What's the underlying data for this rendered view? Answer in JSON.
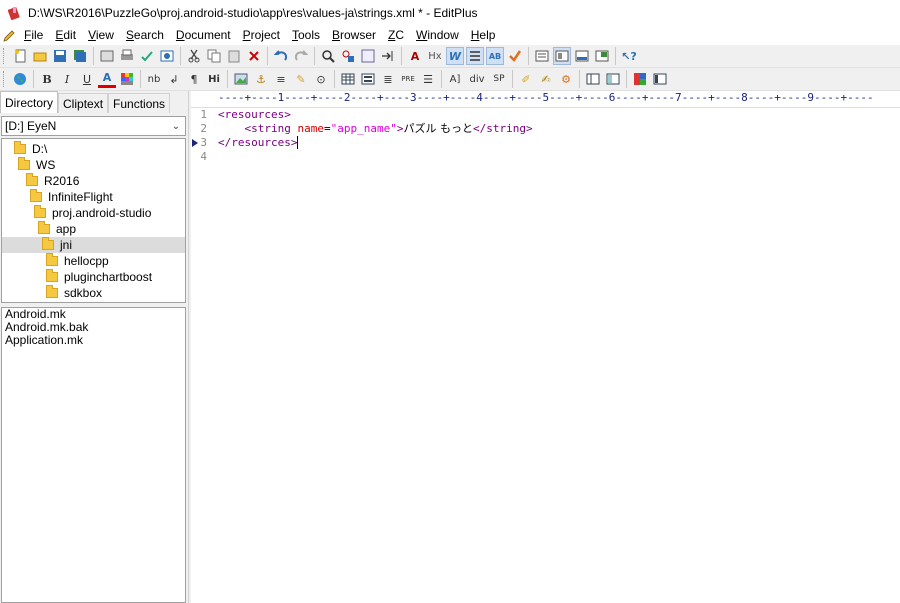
{
  "title": "D:\\WS\\R2016\\PuzzleGo\\proj.android-studio\\app\\res\\values-ja\\strings.xml * - EditPlus",
  "menu": [
    "File",
    "Edit",
    "View",
    "Search",
    "Document",
    "Project",
    "Tools",
    "Browser",
    "ZC",
    "Window",
    "Help"
  ],
  "toolbar1": [
    "new-file-icon",
    "open-file-icon",
    "save-icon",
    "save-all-icon",
    "print-preview-icon",
    "print-icon",
    "spell-check-icon",
    "browser-preview-icon",
    "cut-icon",
    "copy-icon",
    "paste-icon",
    "delete-icon",
    "undo-icon",
    "redo-icon",
    "find-icon",
    "replace-icon",
    "find-in-files-icon",
    "goto-line-icon",
    "font-size-icon",
    "hex-view-icon",
    "word-wrap-icon",
    "line-numbers-icon",
    "ruler-icon",
    "checkmark-icon",
    "directory-window-icon",
    "cliptext-window-icon",
    "output-window-icon",
    "fullscreen-icon",
    "context-help-icon"
  ],
  "toolbar2": {
    "items": [
      {
        "name": "globe-icon",
        "label": "🌐"
      },
      {
        "name": "bold-icon",
        "label": "B"
      },
      {
        "name": "italic-icon",
        "label": "I"
      },
      {
        "name": "underline-icon",
        "label": "U"
      },
      {
        "name": "font-color-icon",
        "label": "A"
      },
      {
        "name": "color-palette-icon",
        "label": "▦"
      },
      {
        "name": "nbsp-icon",
        "label": "nb"
      },
      {
        "name": "line-break-icon",
        "label": "↲"
      },
      {
        "name": "paragraph-icon",
        "label": "¶"
      },
      {
        "name": "heading-icon",
        "label": "Hi"
      },
      {
        "name": "image-icon",
        "label": "▣"
      },
      {
        "name": "anchor-icon",
        "label": "⚓"
      },
      {
        "name": "horizontal-rule-icon",
        "label": "≡"
      },
      {
        "name": "highlight-icon",
        "label": "✎"
      },
      {
        "name": "comment-icon",
        "label": "⊙"
      },
      {
        "name": "table-icon",
        "label": "▤"
      },
      {
        "name": "form-icon",
        "label": "▥"
      },
      {
        "name": "center-icon",
        "label": "≣"
      },
      {
        "name": "pre-icon",
        "label": "PRE"
      },
      {
        "name": "list-icon",
        "label": "☰"
      },
      {
        "name": "form-input-icon",
        "label": "A]"
      },
      {
        "name": "div-icon",
        "label": "div"
      },
      {
        "name": "span-icon",
        "label": "SP"
      },
      {
        "name": "edit-tag-icon",
        "label": "✐"
      },
      {
        "name": "brush-icon",
        "label": "✍"
      },
      {
        "name": "tools-icon",
        "label": "⚙"
      },
      {
        "name": "frame-icon",
        "label": "▦"
      },
      {
        "name": "layout-icon",
        "label": "▧"
      },
      {
        "name": "color-chart-icon",
        "label": "▩"
      },
      {
        "name": "window-icon",
        "label": "▢"
      }
    ]
  },
  "sidebar": {
    "tabs": [
      "Directory",
      "Cliptext",
      "Functions"
    ],
    "drive": "[D:] EyeN",
    "tree": [
      {
        "label": "D:\\",
        "depth": 0
      },
      {
        "label": "WS",
        "depth": 1
      },
      {
        "label": "R2016",
        "depth": 2
      },
      {
        "label": "InfiniteFlight",
        "depth": 3
      },
      {
        "label": "proj.android-studio",
        "depth": 4
      },
      {
        "label": "app",
        "depth": 5
      },
      {
        "label": "jni",
        "depth": 6,
        "selected": true
      },
      {
        "label": "hellocpp",
        "depth": 7
      },
      {
        "label": "pluginchartboost",
        "depth": 7
      },
      {
        "label": "sdkbox",
        "depth": 7
      }
    ],
    "files": [
      "Android.mk",
      "Android.mk.bak",
      "Application.mk"
    ]
  },
  "editor": {
    "ruler": "----+----1----+----2----+----3----+----4----+----5----+----6----+----7----+----8----+----9----+----",
    "line_numbers": [
      "1",
      "2",
      "3",
      "4"
    ],
    "lines": {
      "l1_open": "<resources>",
      "l2_indent": "    ",
      "l2_tag_open": "<string",
      "l2_attr": "name",
      "l2_eq": "=",
      "l2_val": "\"app_name\"",
      "l2_gt": ">",
      "l2_text": "パズル もっと",
      "l2_close": "</string>",
      "l3_close": "</resources>"
    }
  }
}
